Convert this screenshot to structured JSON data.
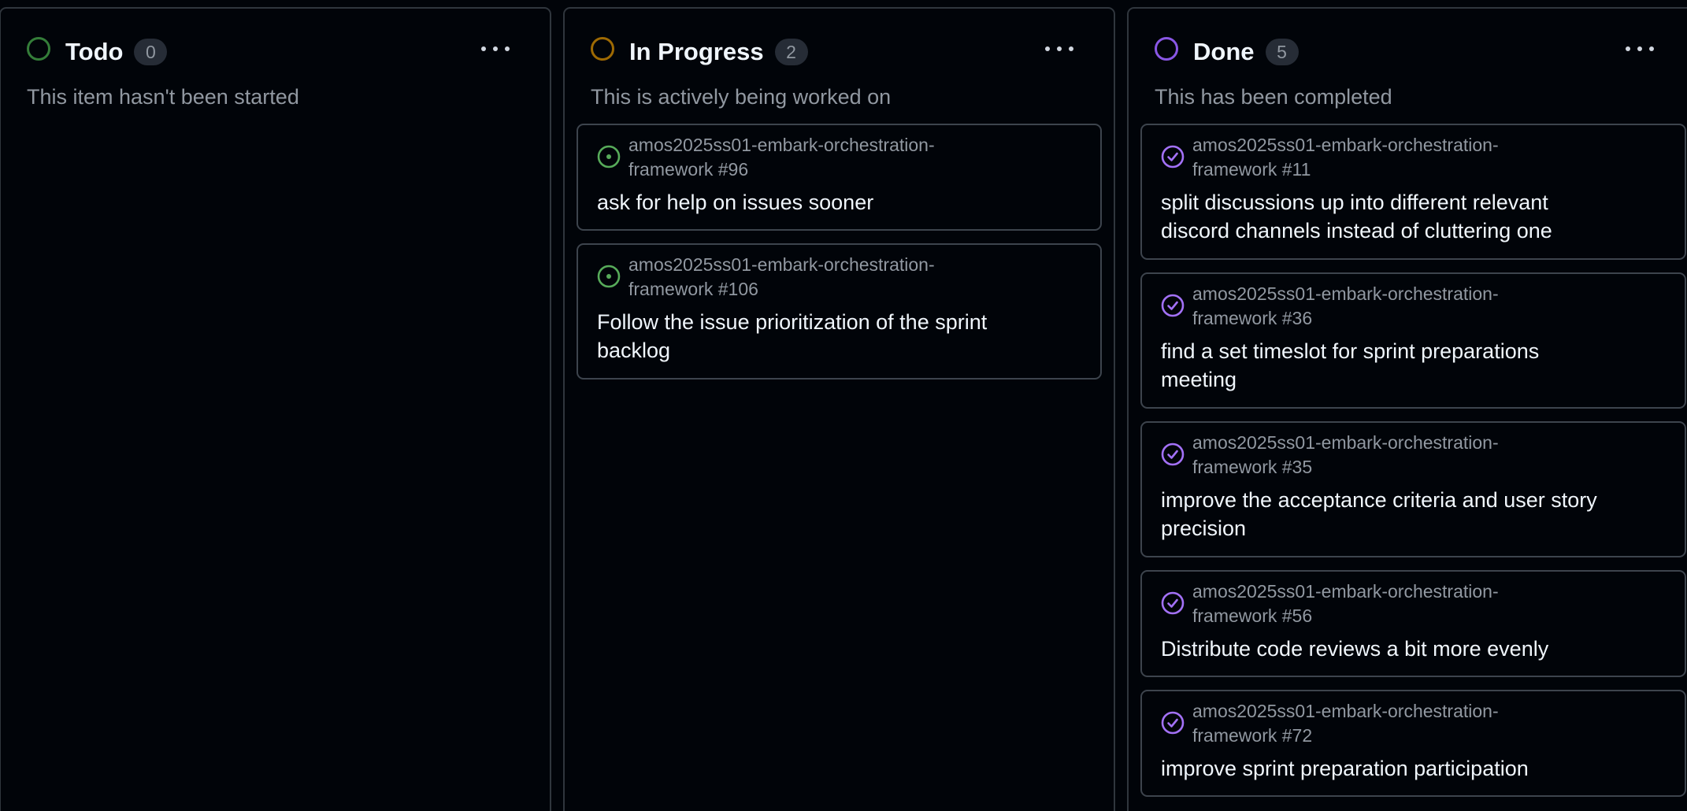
{
  "colors": {
    "todo": "#347d39",
    "in_progress": "#9e6a03",
    "done": "#8957e5",
    "open_issue": "#57ab5a",
    "closed_issue": "#a371f7"
  },
  "columns": [
    {
      "title": "Todo",
      "count": "0",
      "description": "This item hasn't been started",
      "more_icon": "kebab-horizontal-icon",
      "cards": []
    },
    {
      "title": "In Progress",
      "count": "2",
      "description": "This is actively being worked on",
      "more_icon": "kebab-horizontal-icon",
      "cards": [
        {
          "icon": "issue-open-icon",
          "repo_line1": "amos2025ss01-embark-orchestration-",
          "repo_line2": "framework #96",
          "title_line1": "ask for help on issues sooner",
          "title_line2": ""
        },
        {
          "icon": "issue-open-icon",
          "repo_line1": "amos2025ss01-embark-orchestration-",
          "repo_line2": "framework #106",
          "title_line1": "Follow the issue prioritization of the sprint",
          "title_line2": "backlog"
        }
      ]
    },
    {
      "title": "Done",
      "count": "5",
      "description": "This has been completed",
      "more_icon": "kebab-horizontal-icon",
      "cards": [
        {
          "icon": "issue-closed-icon",
          "repo_line1": "amos2025ss01-embark-orchestration-",
          "repo_line2": "framework #11",
          "title_line1": "split discussions up into different relevant",
          "title_line2": "discord channels instead of cluttering one"
        },
        {
          "icon": "issue-closed-icon",
          "repo_line1": "amos2025ss01-embark-orchestration-",
          "repo_line2": "framework #36",
          "title_line1": "find a set timeslot for sprint preparations",
          "title_line2": "meeting"
        },
        {
          "icon": "issue-closed-icon",
          "repo_line1": "amos2025ss01-embark-orchestration-",
          "repo_line2": "framework #35",
          "title_line1": "improve the acceptance criteria and user story",
          "title_line2": "precision"
        },
        {
          "icon": "issue-closed-icon",
          "repo_line1": "amos2025ss01-embark-orchestration-",
          "repo_line2": "framework #56",
          "title_line1": "Distribute code reviews a bit more evenly",
          "title_line2": ""
        },
        {
          "icon": "issue-closed-icon",
          "repo_line1": "amos2025ss01-embark-orchestration-",
          "repo_line2": "framework #72",
          "title_line1": "improve sprint preparation participation",
          "title_line2": ""
        }
      ]
    }
  ]
}
